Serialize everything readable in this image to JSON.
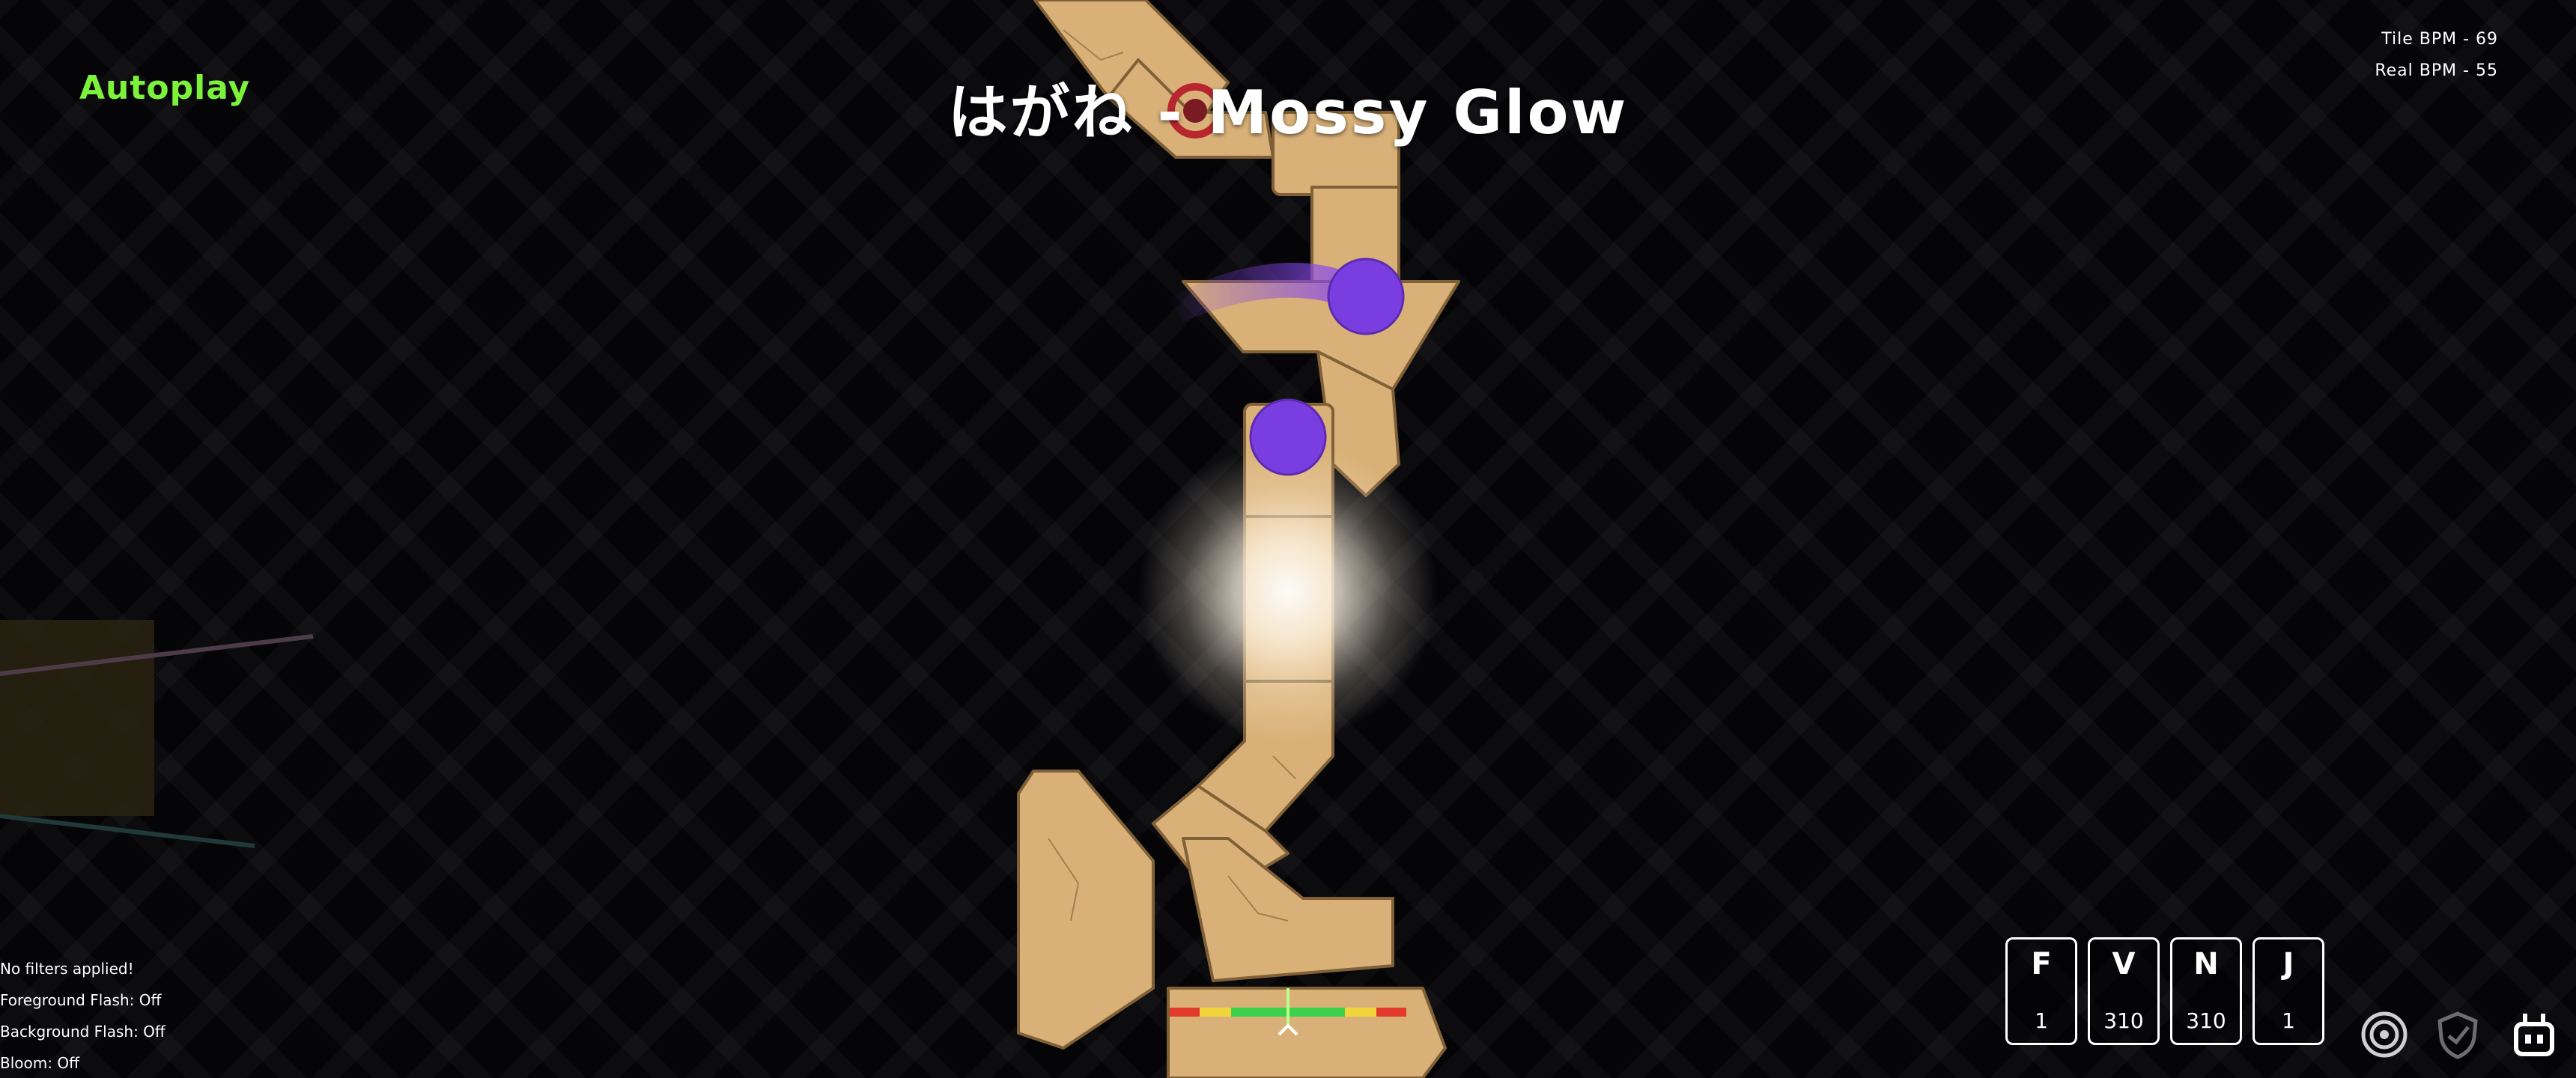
{
  "autoplay_label": "Autoplay",
  "song_title": "はがね - Mossy Glow",
  "bpm": {
    "tile": "Tile BPM - 69",
    "real": "Real BPM - 55"
  },
  "status_lines": [
    "No filters applied!",
    "Foreground Flash: Off",
    "Background Flash: Off",
    "Bloom: Off"
  ],
  "key_counters": [
    {
      "key": "F",
      "count": "1"
    },
    {
      "key": "V",
      "count": "310"
    },
    {
      "key": "N",
      "count": "310"
    },
    {
      "key": "J",
      "count": "1"
    }
  ],
  "corner_icons": [
    "target-icon",
    "shield-icon",
    "robot-icon"
  ],
  "colors": {
    "autoplay": "#7df23a",
    "tile": "#d9b178",
    "planet": "#7a3ee0",
    "background": "#050508"
  }
}
